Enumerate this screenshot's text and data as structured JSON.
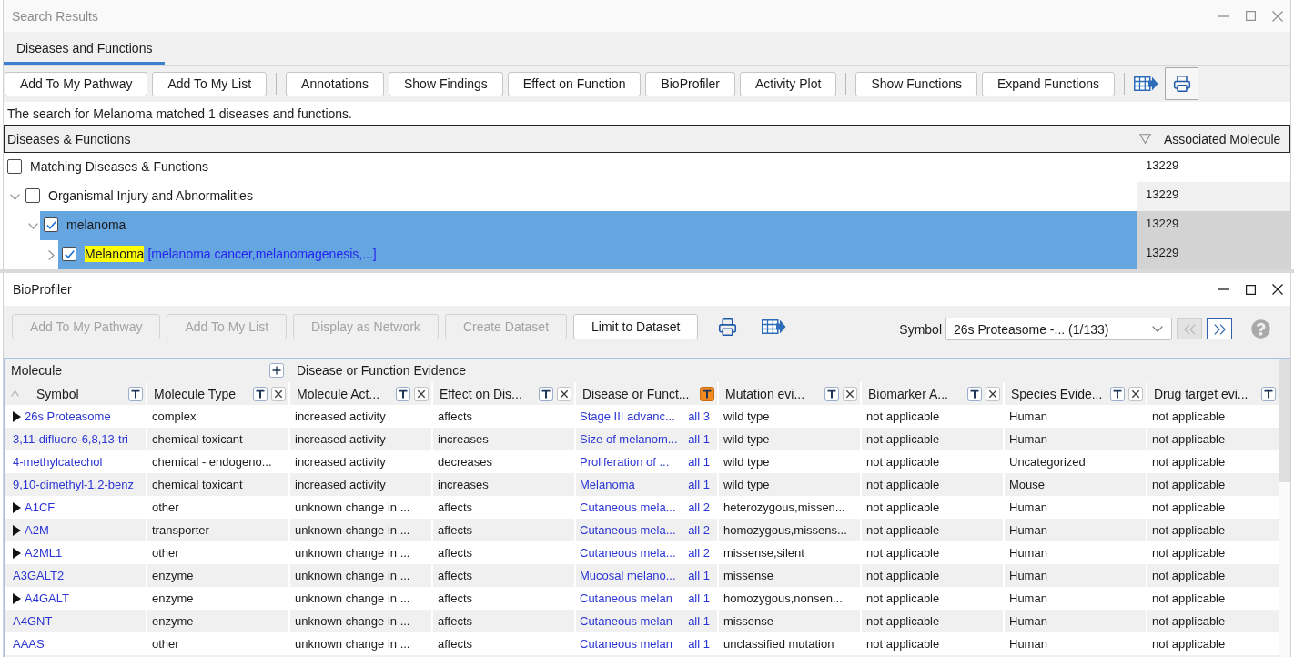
{
  "search_results": {
    "title": "Search Results",
    "tabs": [
      {
        "label": "Diseases and Functions",
        "selected": true
      }
    ],
    "toolbar_groups": [
      [
        "Add To My Pathway",
        "Add To My List"
      ],
      [
        "Annotations",
        "Show Findings",
        "Effect on Function",
        "BioProfiler",
        "Activity Plot"
      ],
      [
        "Show Functions",
        "Expand Functions"
      ]
    ],
    "message": "The search for Melanoma matched 1 diseases and functions.",
    "tree": {
      "columns": [
        "Diseases & Functions",
        "Associated Molecule"
      ],
      "root": {
        "label": "Matching Diseases & Functions",
        "checked": false,
        "selected": false,
        "highlighted": false,
        "count": "13229",
        "children": [
          {
            "label": "Organismal Injury and Abnormalities",
            "checked": false,
            "selected": false,
            "expanded": true,
            "highlighted": false,
            "count": "13229",
            "children": [
              {
                "label": "melanoma",
                "checked": true,
                "selected": true,
                "expanded": true,
                "highlighted": false,
                "count": "13229",
                "children": [
                  {
                    "label": "Melanoma",
                    "synonyms": "[melanoma cancer,melanomagenesis,...]",
                    "checked": true,
                    "selected": true,
                    "expanded": false,
                    "highlighted": true,
                    "count": "13229"
                  }
                ]
              }
            ]
          }
        ]
      }
    }
  },
  "bioprofiler": {
    "title": "BioProfiler",
    "toolbar": [
      {
        "label": "Add To My Pathway",
        "disabled": true
      },
      {
        "label": "Add To My List",
        "disabled": true
      },
      {
        "label": "Display as Network",
        "disabled": true
      },
      {
        "label": "Create Dataset",
        "disabled": true
      },
      {
        "label": "Limit to Dataset",
        "disabled": false
      }
    ],
    "symbol_filter": {
      "label": "Symbol",
      "value": "26s Proteasome -... (1/133)"
    },
    "pager": {
      "previous_disabled": true,
      "next_disabled": false
    },
    "table": {
      "groups": [
        {
          "label": "Molecule",
          "add_button": true,
          "columns": [
            {
              "label": "Symbol",
              "kind": "symbol",
              "sorted": true,
              "filter_active": false,
              "removable": false
            },
            {
              "label": "Molecule Type",
              "kind": "text",
              "sorted": false,
              "filter_active": false,
              "removable": true
            }
          ]
        },
        {
          "label": "Disease or Function Evidence",
          "add_button": false,
          "columns": [
            {
              "label": "Molecule Act...",
              "kind": "text",
              "sorted": false,
              "filter_active": false,
              "removable": true
            },
            {
              "label": "Effect on Dis...",
              "kind": "text",
              "sorted": false,
              "filter_active": false,
              "removable": true
            },
            {
              "label": "Disease or Funct...",
              "kind": "finding",
              "sorted": false,
              "filter_active": true,
              "removable": false
            },
            {
              "label": "Mutation evi...",
              "kind": "text",
              "sorted": false,
              "filter_active": false,
              "removable": true
            },
            {
              "label": "Biomarker A...",
              "kind": "text",
              "sorted": false,
              "filter_active": false,
              "removable": true
            },
            {
              "label": "Species Evide...",
              "kind": "text",
              "sorted": false,
              "filter_active": false,
              "removable": true
            },
            {
              "label": "Drug target evi...",
              "kind": "text",
              "sorted": false,
              "filter_active": false,
              "removable": false
            }
          ]
        }
      ],
      "rows": [
        {
          "expandable": true,
          "cells": [
            "26s Proteasome",
            "complex",
            "increased activity",
            "affects",
            "Stage III advanc...",
            "wild type",
            "not applicable",
            "Human",
            "not applicable"
          ],
          "finding_count": "all 3"
        },
        {
          "expandable": false,
          "cells": [
            "3,11-difluoro-6,8,13-tri",
            "chemical toxicant",
            "increased activity",
            "increases",
            "Size of melanom...",
            "wild type",
            "not applicable",
            "Human",
            "not applicable"
          ],
          "finding_count": "all 1"
        },
        {
          "expandable": false,
          "cells": [
            "4-methylcatechol",
            "chemical - endogeno...",
            "increased activity",
            "decreases",
            "Proliferation of ...",
            "wild type",
            "not applicable",
            "Uncategorized",
            "not applicable"
          ],
          "finding_count": "all 1"
        },
        {
          "expandable": false,
          "cells": [
            "9,10-dimethyl-1,2-benz",
            "chemical toxicant",
            "increased activity",
            "increases",
            "Melanoma",
            "wild type",
            "not applicable",
            "Mouse",
            "not applicable"
          ],
          "finding_count": "all 1"
        },
        {
          "expandable": true,
          "cells": [
            "A1CF",
            "other",
            "unknown change in ...",
            "affects",
            "Cutaneous mela...",
            "heterozygous,missen...",
            "not applicable",
            "Human",
            "not applicable"
          ],
          "finding_count": "all 2"
        },
        {
          "expandable": true,
          "cells": [
            "A2M",
            "transporter",
            "unknown change in ...",
            "affects",
            "Cutaneous mela...",
            "homozygous,missens...",
            "not applicable",
            "Human",
            "not applicable"
          ],
          "finding_count": "all 2"
        },
        {
          "expandable": true,
          "cells": [
            "A2ML1",
            "other",
            "unknown change in ...",
            "affects",
            "Cutaneous mela...",
            "missense,silent",
            "not applicable",
            "Human",
            "not applicable"
          ],
          "finding_count": "all 2"
        },
        {
          "expandable": false,
          "cells": [
            "A3GALT2",
            "enzyme",
            "unknown change in ...",
            "affects",
            "Mucosal melano...",
            "missense",
            "not applicable",
            "Human",
            "not applicable"
          ],
          "finding_count": "all 1"
        },
        {
          "expandable": true,
          "cells": [
            "A4GALT",
            "enzyme",
            "unknown change in ...",
            "affects",
            "Cutaneous melan",
            "homozygous,nonsen...",
            "not applicable",
            "Human",
            "not applicable"
          ],
          "finding_count": "all 1"
        },
        {
          "expandable": false,
          "cells": [
            "A4GNT",
            "enzyme",
            "unknown change in ...",
            "affects",
            "Cutaneous melan",
            "missense",
            "not applicable",
            "Human",
            "not applicable"
          ],
          "finding_count": "all 1"
        },
        {
          "expandable": false,
          "cells": [
            "AAAS",
            "other",
            "unknown change in ...",
            "affects",
            "Cutaneous melan",
            "unclassified mutation",
            "not applicable",
            "Human",
            "not applicable"
          ],
          "finding_count": "all 1"
        }
      ]
    }
  }
}
